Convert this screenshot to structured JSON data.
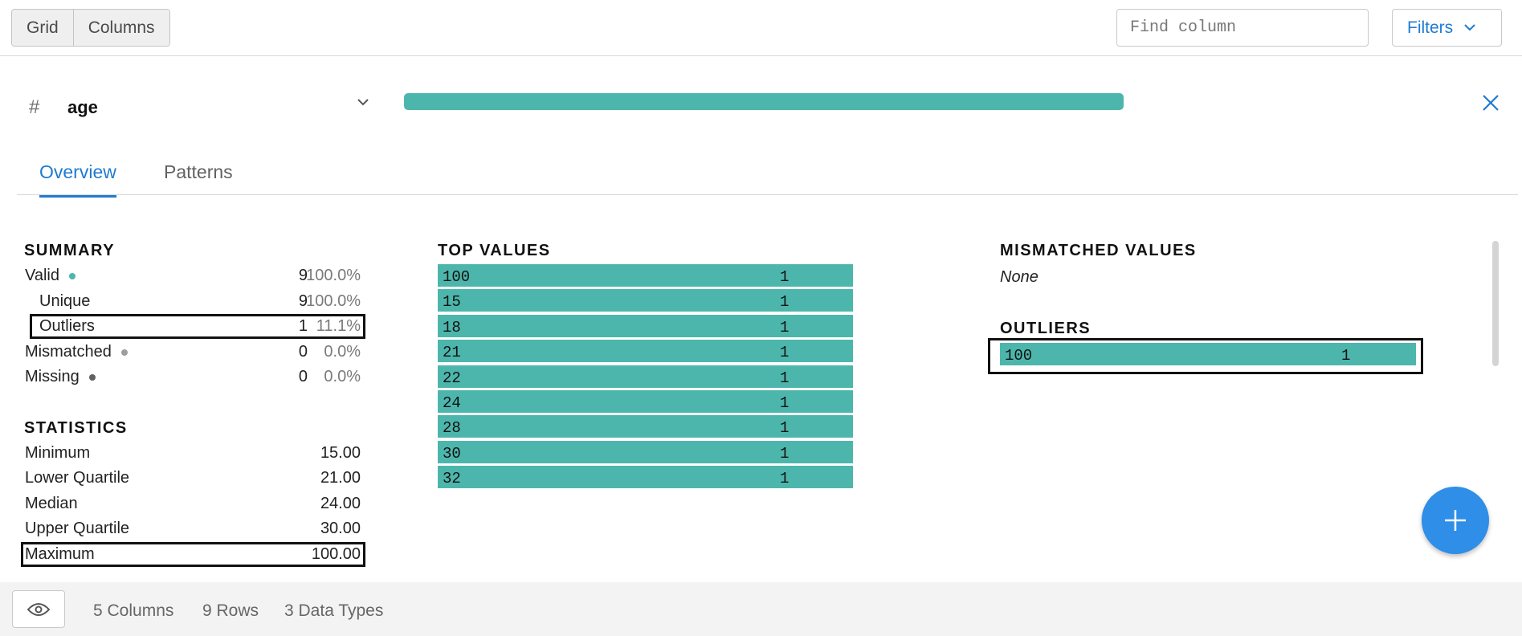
{
  "toolbar": {
    "view_tabs": [
      "Grid",
      "Columns"
    ],
    "find_placeholder": "Find column",
    "filters_label": "Filters"
  },
  "column": {
    "type_symbol": "#",
    "name": "age",
    "valid_fraction": 1.0,
    "bar_color": "#4db6ac"
  },
  "tabs": [
    "Overview",
    "Patterns"
  ],
  "summary": {
    "title": "SUMMARY",
    "rows": [
      {
        "label": "Valid",
        "count": "9",
        "pct": "100.0%",
        "dot_color": "#4db6ac"
      },
      {
        "label": "Unique",
        "count": "9",
        "pct": "100.0%"
      },
      {
        "label": "Outliers",
        "count": "1",
        "pct": "11.1%"
      },
      {
        "label": "Mismatched",
        "count": "0",
        "pct": "0.0%",
        "dot_color": "#9e9e9e"
      },
      {
        "label": "Missing",
        "count": "0",
        "pct": "0.0%",
        "dot_color": "#616161"
      }
    ]
  },
  "statistics": {
    "title": "STATISTICS",
    "rows": [
      {
        "label": "Minimum",
        "value": "15.00"
      },
      {
        "label": "Lower Quartile",
        "value": "21.00"
      },
      {
        "label": "Median",
        "value": "24.00"
      },
      {
        "label": "Upper Quartile",
        "value": "30.00"
      },
      {
        "label": "Maximum",
        "value": "100.00"
      }
    ]
  },
  "top_values": {
    "title": "TOP VALUES",
    "items": [
      {
        "value": "100",
        "count": "1"
      },
      {
        "value": "15",
        "count": "1"
      },
      {
        "value": "18",
        "count": "1"
      },
      {
        "value": "21",
        "count": "1"
      },
      {
        "value": "22",
        "count": "1"
      },
      {
        "value": "24",
        "count": "1"
      },
      {
        "value": "28",
        "count": "1"
      },
      {
        "value": "30",
        "count": "1"
      },
      {
        "value": "32",
        "count": "1"
      }
    ]
  },
  "mismatched": {
    "title": "MISMATCHED VALUES",
    "value": "None"
  },
  "outliers": {
    "title": "OUTLIERS",
    "items": [
      {
        "value": "100",
        "count": "1"
      }
    ]
  },
  "footer": {
    "columns": "5 Columns",
    "rows": "9 Rows",
    "types": "3 Data Types"
  },
  "colors": {
    "accent": "#1e7bd2",
    "bar": "#4db6ac",
    "fab": "#2e8ee8"
  },
  "icons": [
    "chevron-down-icon",
    "close-icon",
    "plus-icon",
    "eye-icon"
  ]
}
